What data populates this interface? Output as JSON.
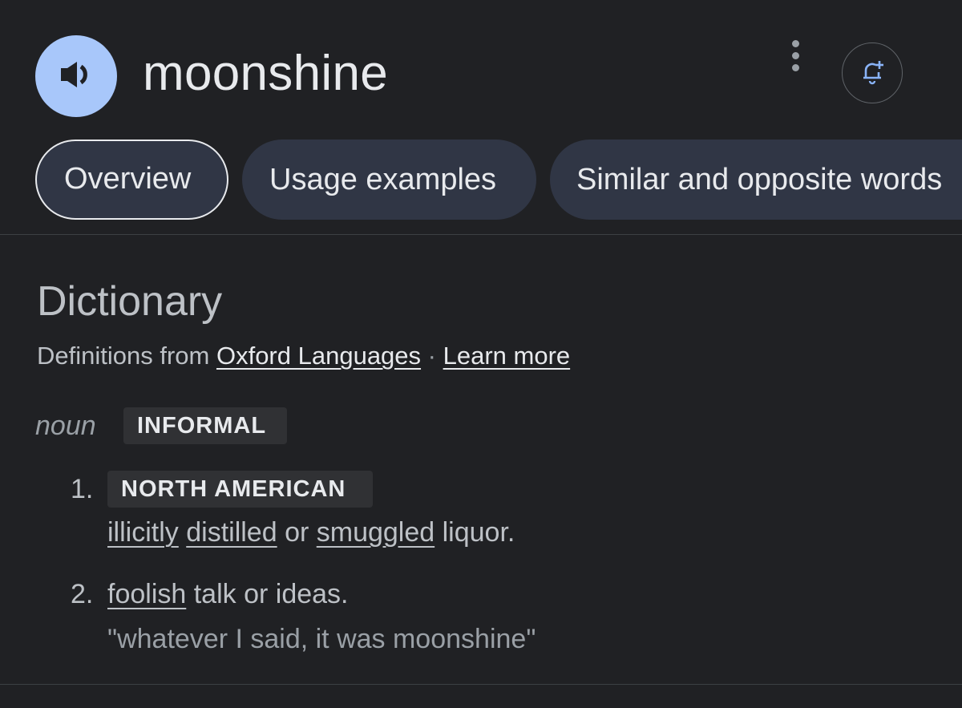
{
  "header": {
    "word": "moonshine",
    "audio_icon": "speaker-icon",
    "more_icon": "more-vert-icon",
    "alert_icon": "bell-plus-icon"
  },
  "tabs": [
    {
      "label": "Overview",
      "active": true
    },
    {
      "label": "Usage examples",
      "active": false
    },
    {
      "label": "Similar and opposite words",
      "active": false
    }
  ],
  "dictionary": {
    "title": "Dictionary",
    "source_prefix": "Definitions from ",
    "source_link": "Oxford Languages",
    "separator": " · ",
    "learn_more": "Learn more",
    "part_of_speech": "noun",
    "register": "INFORMAL",
    "definitions": [
      {
        "number": "1.",
        "label": "NORTH AMERICAN",
        "words": [
          "illicitly",
          " ",
          "distilled",
          " or ",
          "smuggled",
          " liquor."
        ]
      },
      {
        "number": "2.",
        "words": [
          "foolish",
          " talk or ideas."
        ],
        "example": "\"whatever I said, it was moonshine\""
      }
    ]
  },
  "colors": {
    "background": "#202124",
    "audio_button": "#a8c7fa",
    "tab_background": "#303645",
    "badge_background": "#303134",
    "bell_accent": "#8ab4f8"
  }
}
